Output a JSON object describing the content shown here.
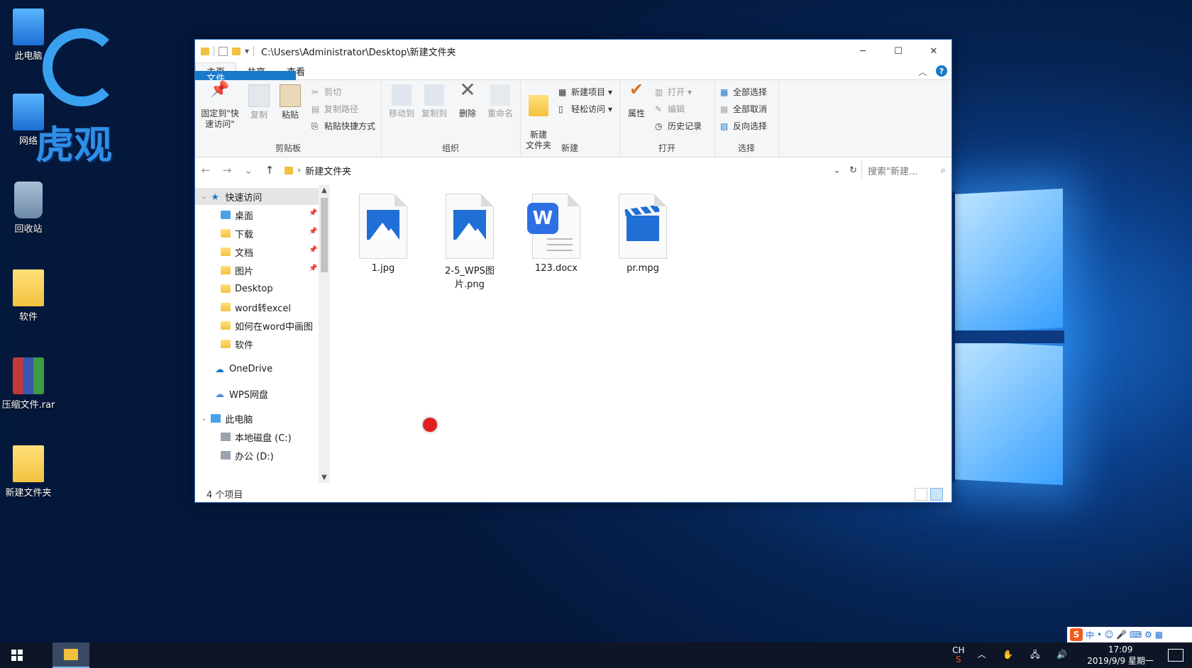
{
  "desktop": {
    "brand_text": "虎观",
    "icons": [
      {
        "label": "此电脑"
      },
      {
        "label": "网络"
      },
      {
        "label": "回收站"
      },
      {
        "label": "软件"
      },
      {
        "label": "压缩文件.rar"
      },
      {
        "label": "新建文件夹"
      }
    ]
  },
  "window": {
    "title": "C:\\Users\\Administrator\\Desktop\\新建文件夹",
    "controls": {
      "minimize": "─",
      "maximize": "☐",
      "close": "✕"
    },
    "tabs": [
      "文件",
      "主页",
      "共享",
      "查看"
    ],
    "active_tab": "主页"
  },
  "ribbon": {
    "clipboard": {
      "label": "剪贴板",
      "pin": "固定到\"快速访问\"",
      "copy": "复制",
      "paste": "粘贴",
      "cut": "剪切",
      "copy_path": "复制路径",
      "paste_shortcut": "粘贴快捷方式"
    },
    "organize": {
      "label": "组织",
      "move_to": "移动到",
      "copy_to": "复制到",
      "delete": "删除",
      "rename": "重命名"
    },
    "new": {
      "label": "新建",
      "new_folder": "新建\n文件夹",
      "new_item": "新建项目",
      "easy_access": "轻松访问"
    },
    "open": {
      "label": "打开",
      "properties": "属性",
      "open": "打开",
      "edit": "编辑",
      "history": "历史记录"
    },
    "select": {
      "label": "选择",
      "select_all": "全部选择",
      "select_none": "全部取消",
      "invert": "反向选择"
    }
  },
  "address": {
    "path": "新建文件夹",
    "search_placeholder": "搜索\"新建...",
    "back": "←",
    "forward": "→",
    "recent": "⌄",
    "up": "↑",
    "refresh": "↻"
  },
  "nav": {
    "quick_access": "快速访问",
    "quick_items": [
      "桌面",
      "下载",
      "文档",
      "图片",
      "Desktop",
      "word转excel",
      "如何在word中画图",
      "软件"
    ],
    "onedrive": "OneDrive",
    "wps": "WPS网盘",
    "this_pc": "此电脑",
    "drives": [
      "本地磁盘 (C:)",
      "办公 (D:)"
    ]
  },
  "files": [
    {
      "name": "1.jpg",
      "kind": "image"
    },
    {
      "name": "2-5_WPS图片.png",
      "kind": "image"
    },
    {
      "name": "123.docx",
      "kind": "word"
    },
    {
      "name": "pr.mpg",
      "kind": "video"
    }
  ],
  "status": {
    "count": "4 个项目"
  },
  "taskbar": {
    "lang": "CH",
    "time": "17:09",
    "date": "2019/9/9 星期一",
    "ime_label": "中"
  },
  "colors": {
    "accent": "#1979ca",
    "desktop": "#0b3d86"
  }
}
